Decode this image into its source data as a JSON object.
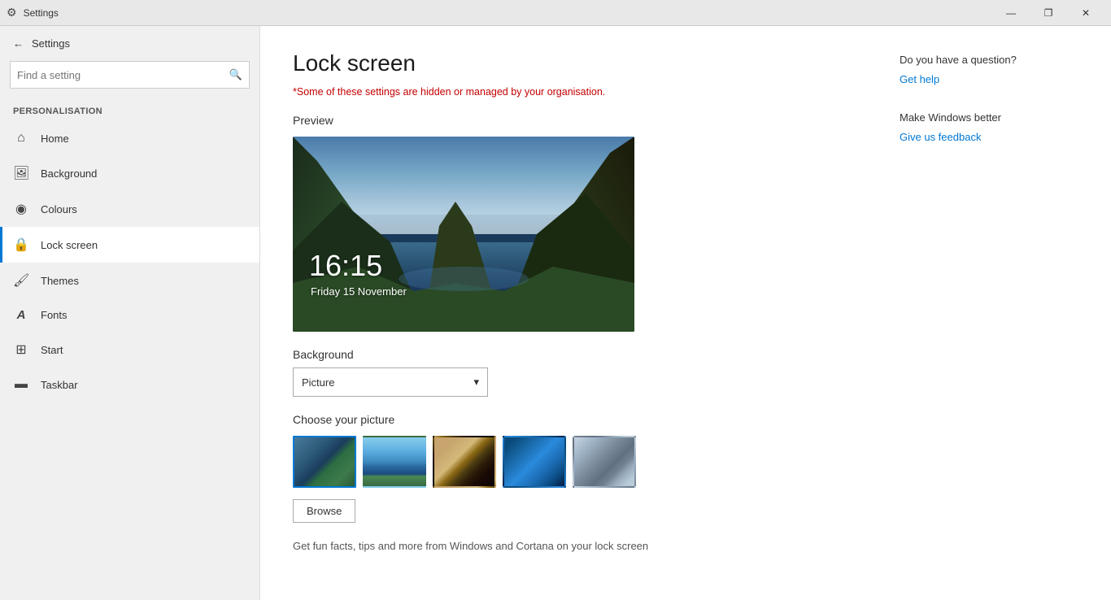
{
  "titlebar": {
    "icon": "⚙",
    "title": "Settings",
    "minimize_label": "—",
    "restore_label": "❐",
    "close_label": "✕"
  },
  "sidebar": {
    "back_label": "←",
    "search_placeholder": "Find a setting",
    "personalisation_label": "Personalisation",
    "nav_items": [
      {
        "id": "home",
        "icon": "⌂",
        "label": "Home"
      },
      {
        "id": "background",
        "icon": "🖼",
        "label": "Background"
      },
      {
        "id": "colours",
        "icon": "🎨",
        "label": "Colours"
      },
      {
        "id": "lock-screen",
        "icon": "🔒",
        "label": "Lock screen"
      },
      {
        "id": "themes",
        "icon": "🖌",
        "label": "Themes"
      },
      {
        "id": "fonts",
        "icon": "A",
        "label": "Fonts"
      },
      {
        "id": "start",
        "icon": "▦",
        "label": "Start"
      },
      {
        "id": "taskbar",
        "icon": "▬",
        "label": "Taskbar"
      }
    ]
  },
  "main": {
    "page_title": "Lock screen",
    "warning": "*Some of these settings are hidden or managed by your organisation.",
    "preview_label": "Preview",
    "preview_time": "16:15",
    "preview_date": "Friday 15 November",
    "background_label": "Background",
    "background_dropdown_value": "Picture",
    "choose_picture_label": "Choose your picture",
    "browse_label": "Browse",
    "fun_facts_label": "Get fun facts, tips and more from Windows and Cortana on your lock screen"
  },
  "right_panel": {
    "help_title": "Do you have a question?",
    "help_link": "Get help",
    "feedback_title": "Make Windows better",
    "feedback_link": "Give us feedback"
  }
}
